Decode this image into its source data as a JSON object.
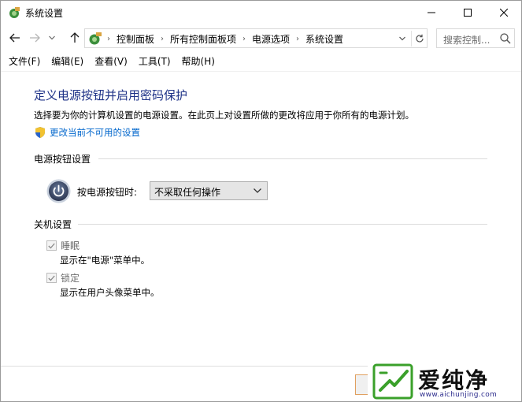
{
  "window": {
    "title": "系统设置"
  },
  "address_bar": {
    "crumbs": [
      "控制面板",
      "所有控制面板项",
      "电源选项",
      "系统设置"
    ]
  },
  "search": {
    "placeholder": "搜索控制..."
  },
  "menu": {
    "items": [
      "文件(F)",
      "编辑(E)",
      "查看(V)",
      "工具(T)",
      "帮助(H)"
    ]
  },
  "content": {
    "heading": "定义电源按钮并启用密码保护",
    "description": "选择要为你的计算机设置的电源设置。在此页上对设置所做的更改将应用于你所有的电源计划。",
    "change_link": "更改当前不可用的设置",
    "power_section": {
      "title": "电源按钮设置",
      "label": "按电源按钮时:",
      "selected_option": "不采取任何操作"
    },
    "shutdown_section": {
      "title": "关机设置",
      "options": [
        {
          "label": "睡眠",
          "checked": true,
          "description": "显示在\"电源\"菜单中。"
        },
        {
          "label": "锁定",
          "checked": true,
          "description": "显示在用户头像菜单中。"
        }
      ]
    }
  },
  "watermark": {
    "brand": "爱纯净",
    "url": "www.aichunjing.com"
  },
  "colors": {
    "heading": "#1e3287",
    "link": "#0066cc",
    "watermark_green": "#3aa02a"
  }
}
